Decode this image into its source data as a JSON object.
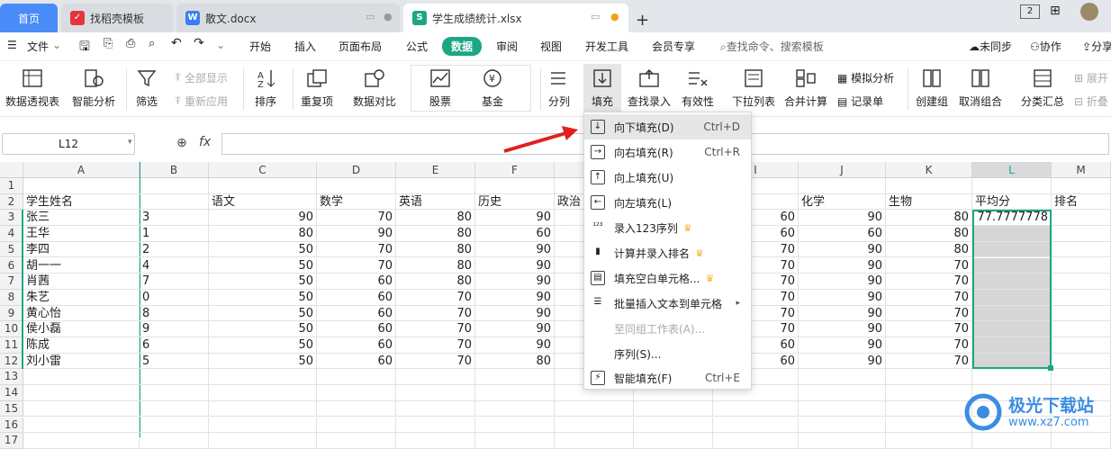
{
  "tabs": {
    "home": "首页",
    "daoke": "找稻壳模板",
    "doc": "散文.docx",
    "xlsx": "学生成绩统计.xlsx"
  },
  "menubar": {
    "file": "文件",
    "items": [
      "开始",
      "插入",
      "页面布局",
      "公式",
      "数据",
      "审阅",
      "视图",
      "开发工具",
      "会员专享"
    ],
    "search": "查找命令、搜索模板",
    "unsync": "未同步",
    "collab": "协作",
    "share": "分享"
  },
  "ribbon": {
    "pivot": "数据透视表",
    "smart": "智能分析",
    "filter": "筛选",
    "show_all": "全部显示",
    "reapply": "重新应用",
    "sort": "排序",
    "duplicates": "重复项",
    "compare": "数据对比",
    "stock": "股票",
    "fund": "基金",
    "split": "分列",
    "fill": "填充",
    "lookup": "查找录入",
    "validity": "有效性",
    "dropdown": "下拉列表",
    "merge_calc": "合并计算",
    "simulate": "模拟分析",
    "record": "记录单",
    "group": "创建组",
    "ungroup": "取消组合",
    "subtotal": "分类汇总",
    "expand": "展开",
    "collapse": "折叠"
  },
  "formula": {
    "namebox": "L12",
    "fx": "fx"
  },
  "columns": [
    "A",
    "B",
    "C",
    "D",
    "E",
    "F",
    "G",
    "H",
    "I",
    "J",
    "K",
    "L",
    "M"
  ],
  "headers": {
    "A": "学生姓名",
    "C": "语文",
    "D": "数学",
    "E": "英语",
    "F": "历史",
    "G": "政治",
    "J": "化学",
    "K": "生物",
    "L": "平均分",
    "M": "排名"
  },
  "rows": [
    {
      "n": "3",
      "name": "张三",
      "b": "3",
      "c": "90",
      "d": "70",
      "e": "80",
      "f": "90",
      "i": "60",
      "j": "90",
      "k": "80",
      "l": "77.7777778"
    },
    {
      "n": "4",
      "name": "王华",
      "b": "1",
      "c": "80",
      "d": "90",
      "e": "80",
      "f": "60",
      "i": "60",
      "j": "60",
      "k": "80",
      "l": ""
    },
    {
      "n": "5",
      "name": "李四",
      "b": "2",
      "c": "50",
      "d": "70",
      "e": "80",
      "f": "90",
      "i": "70",
      "j": "90",
      "k": "80",
      "l": ""
    },
    {
      "n": "6",
      "name": "胡一一",
      "b": "4",
      "c": "50",
      "d": "70",
      "e": "80",
      "f": "90",
      "i": "70",
      "j": "90",
      "k": "70",
      "l": ""
    },
    {
      "n": "7",
      "name": "肖茜",
      "b": "7",
      "c": "50",
      "d": "60",
      "e": "80",
      "f": "90",
      "i": "70",
      "j": "90",
      "k": "70",
      "l": ""
    },
    {
      "n": "8",
      "name": "朱艺",
      "b": "0",
      "c": "50",
      "d": "60",
      "e": "70",
      "f": "90",
      "i": "70",
      "j": "90",
      "k": "70",
      "l": ""
    },
    {
      "n": "9",
      "name": "黄心怡",
      "b": "8",
      "c": "50",
      "d": "60",
      "e": "70",
      "f": "90",
      "i": "70",
      "j": "90",
      "k": "70",
      "l": ""
    },
    {
      "n": "10",
      "name": "侯小磊",
      "b": "9",
      "c": "50",
      "d": "60",
      "e": "70",
      "f": "90",
      "i": "70",
      "j": "90",
      "k": "70",
      "l": ""
    },
    {
      "n": "11",
      "name": "陈成",
      "b": "6",
      "c": "50",
      "d": "60",
      "e": "70",
      "f": "90",
      "i": "60",
      "j": "90",
      "k": "70",
      "l": ""
    },
    {
      "n": "12",
      "name": "刘小雷",
      "b": "5",
      "c": "50",
      "d": "60",
      "e": "70",
      "f": "80",
      "i": "60",
      "j": "90",
      "k": "70",
      "l": ""
    }
  ],
  "empty_rows": [
    "13",
    "14",
    "15",
    "16",
    "17"
  ],
  "header_row": "2",
  "top_row": "1",
  "fill_menu": {
    "down": {
      "label": "向下填充(D)",
      "shortcut": "Ctrl+D"
    },
    "right": {
      "label": "向右填充(R)",
      "shortcut": "Ctrl+R"
    },
    "up": {
      "label": "向上填充(U)"
    },
    "left": {
      "label": "向左填充(L)"
    },
    "seq123": {
      "label": "录入123序列"
    },
    "rank": {
      "label": "计算并录入排名"
    },
    "blank": {
      "label": "填充空白单元格..."
    },
    "batch": {
      "label": "批量插入文本到单元格"
    },
    "same_group": {
      "label": "至同组工作表(A)..."
    },
    "series": {
      "label": "序列(S)..."
    },
    "smart": {
      "label": "智能填充(F)",
      "shortcut": "Ctrl+E"
    }
  },
  "watermark": {
    "name": "极光下载站",
    "url": "www.xz7.com"
  },
  "colors": {
    "accent": "#1ba784",
    "home_tab": "#4a8cf7",
    "arrow": "#e02020",
    "crown": "#f3b330"
  }
}
